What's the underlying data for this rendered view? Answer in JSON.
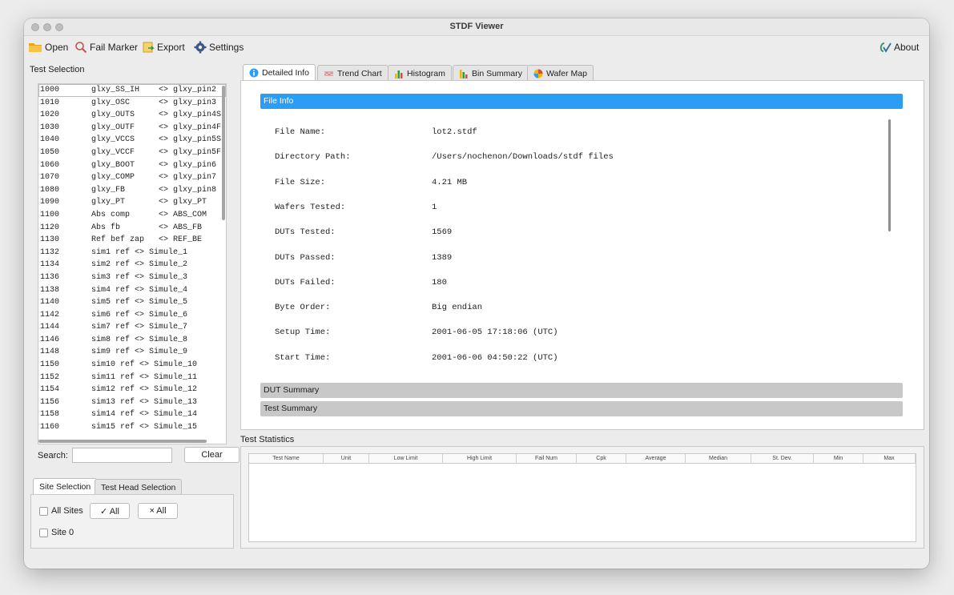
{
  "window": {
    "title": "STDF Viewer"
  },
  "toolbar": {
    "open": "Open",
    "fail_marker": "Fail Marker",
    "export": "Export",
    "settings": "Settings",
    "about": "About"
  },
  "test_selection": {
    "label": "Test Selection",
    "items": [
      {
        "num": "1000",
        "name": "glxy_SS_IH    <> glxy_pin2"
      },
      {
        "num": "1010",
        "name": "glxy_OSC      <> glxy_pin3"
      },
      {
        "num": "1020",
        "name": "glxy_OUTS     <> glxy_pin4S"
      },
      {
        "num": "1030",
        "name": "glxy_OUTF     <> glxy_pin4F"
      },
      {
        "num": "1040",
        "name": "glxy_VCCS     <> glxy_pin5S"
      },
      {
        "num": "1050",
        "name": "glxy_VCCF     <> glxy_pin5F"
      },
      {
        "num": "1060",
        "name": "glxy_BOOT     <> glxy_pin6"
      },
      {
        "num": "1070",
        "name": "glxy_COMP     <> glxy_pin7"
      },
      {
        "num": "1080",
        "name": "glxy_FB       <> glxy_pin8"
      },
      {
        "num": "1090",
        "name": "glxy_PT       <> glxy_PT"
      },
      {
        "num": "1100",
        "name": "Abs comp      <> ABS_COM"
      },
      {
        "num": "1120",
        "name": "Abs fb        <> ABS_FB"
      },
      {
        "num": "1130",
        "name": "Ref bef zap   <> REF_BE"
      },
      {
        "num": "1132",
        "name": "sim1 ref <> Simule_1"
      },
      {
        "num": "1134",
        "name": "sim2 ref <> Simule_2"
      },
      {
        "num": "1136",
        "name": "sim3 ref <> Simule_3"
      },
      {
        "num": "1138",
        "name": "sim4 ref <> Simule_4"
      },
      {
        "num": "1140",
        "name": "sim5 ref <> Simule_5"
      },
      {
        "num": "1142",
        "name": "sim6 ref <> Simule_6"
      },
      {
        "num": "1144",
        "name": "sim7 ref <> Simule_7"
      },
      {
        "num": "1146",
        "name": "sim8 ref <> Simule_8"
      },
      {
        "num": "1148",
        "name": "sim9 ref <> Simule_9"
      },
      {
        "num": "1150",
        "name": "sim10 ref <> Simule_10"
      },
      {
        "num": "1152",
        "name": "sim11 ref <> Simule_11"
      },
      {
        "num": "1154",
        "name": "sim12 ref <> Simule_12"
      },
      {
        "num": "1156",
        "name": "sim13 ref <> Simule_13"
      },
      {
        "num": "1158",
        "name": "sim14 ref <> Simule_14"
      },
      {
        "num": "1160",
        "name": "sim15 ref <> Simule_15"
      }
    ],
    "search_label": "Search:",
    "search_value": "",
    "clear_button": "Clear"
  },
  "site_tabs": {
    "tabs": [
      "Site Selection",
      "Test Head Selection"
    ],
    "all_sites": "All Sites",
    "check_all": "✓ All",
    "uncheck_all": "× All",
    "site0": "Site 0"
  },
  "main_tabs": [
    "Detailed Info",
    "Trend Chart",
    "Histogram",
    "Bin Summary",
    "Wafer Map"
  ],
  "file_info": {
    "header": "File Info",
    "rows": [
      {
        "key": "File Name:",
        "value": "lot2.stdf"
      },
      {
        "key": "Directory Path:",
        "value": "/Users/nochenon/Downloads/stdf files"
      },
      {
        "key": "File Size:",
        "value": "4.21 MB"
      },
      {
        "key": "Wafers Tested:",
        "value": "1"
      },
      {
        "key": "DUTs Tested:",
        "value": "1569"
      },
      {
        "key": "DUTs Passed:",
        "value": "1389"
      },
      {
        "key": "DUTs Failed:",
        "value": "180"
      },
      {
        "key": "Byte Order:",
        "value": "Big endian"
      },
      {
        "key": "Setup Time:",
        "value": "2001-06-05 17:18:06 (UTC)"
      },
      {
        "key": "Start Time:",
        "value": "2001-06-06 04:50:22 (UTC)"
      }
    ]
  },
  "dut_summary": "DUT Summary",
  "test_summary": "Test Summary",
  "test_statistics": {
    "label": "Test Statistics",
    "columns": [
      "Test Name",
      "Unit",
      "Low Limit",
      "High Limit",
      "Fail Num",
      "Cpk",
      "Average",
      "Median",
      "St. Dev.",
      "Min",
      "Max"
    ]
  },
  "colors": {
    "accent": "#2a9df4",
    "collapse": "#c8c8c8"
  }
}
